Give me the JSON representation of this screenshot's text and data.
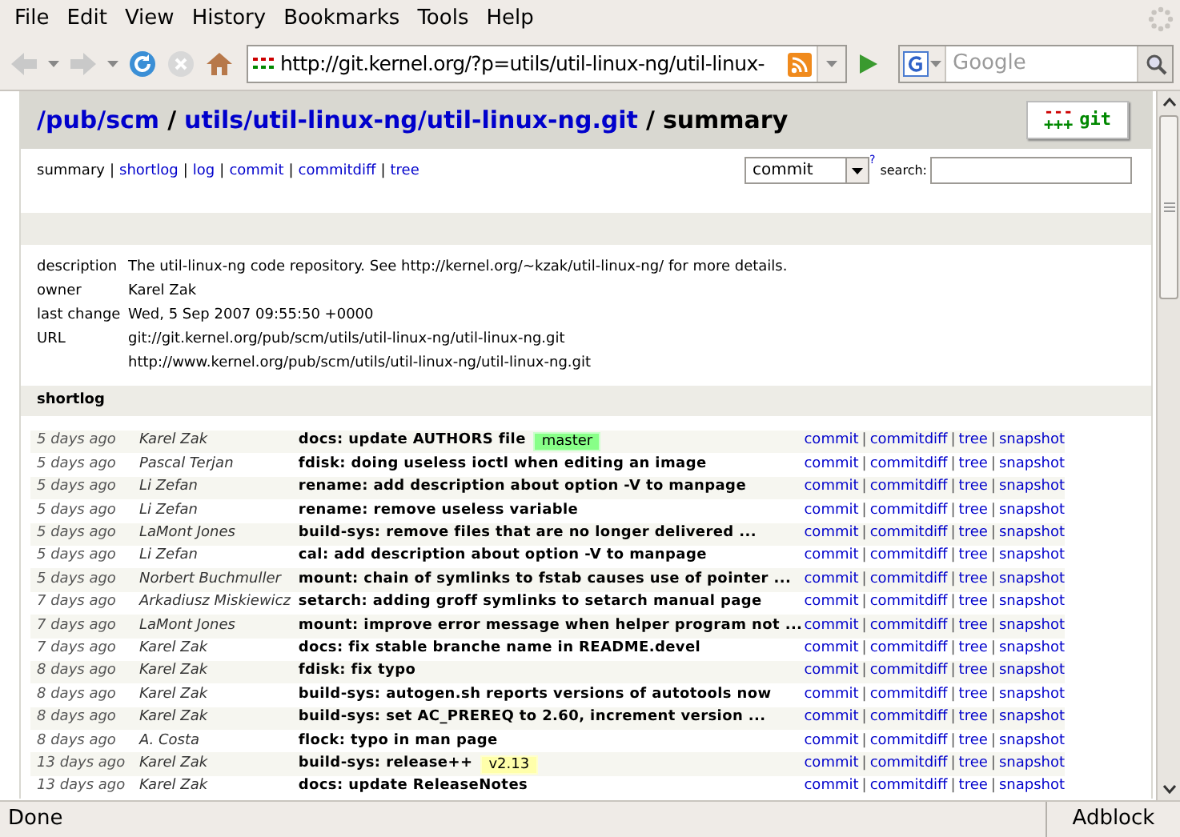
{
  "menu": [
    "File",
    "Edit",
    "View",
    "History",
    "Bookmarks",
    "Tools",
    "Help"
  ],
  "toolbar": {
    "url": "http://git.kernel.org/?p=utils/util-linux-ng/util-linux-",
    "search_placeholder": "Google"
  },
  "page": {
    "breadcrumb": [
      {
        "text": "/pub/scm",
        "link": true
      },
      {
        "text": "/",
        "link": false
      },
      {
        "text": "utils/util-linux-ng/util-linux-ng.git",
        "link": true
      },
      {
        "text": "/",
        "link": false
      },
      {
        "text": "summary",
        "link": false
      }
    ],
    "logo": {
      "minus": "---",
      "plus": "+++",
      "word": "git"
    },
    "nav": [
      {
        "label": "summary",
        "selected": true
      },
      {
        "label": "shortlog",
        "selected": false
      },
      {
        "label": "log",
        "selected": false
      },
      {
        "label": "commit",
        "selected": false
      },
      {
        "label": "commitdiff",
        "selected": false
      },
      {
        "label": "tree",
        "selected": false
      }
    ],
    "separator": "|",
    "search": {
      "type": "commit",
      "help": "?",
      "label": "search:"
    },
    "info": [
      {
        "key": "description",
        "values": [
          "The util-linux-ng code repository. See http://kernel.org/~kzak/util-linux-ng/ for more details."
        ]
      },
      {
        "key": "owner",
        "values": [
          "Karel Zak"
        ]
      },
      {
        "key": "last change",
        "values": [
          "Wed, 5 Sep 2007 09:55:50 +0000"
        ]
      },
      {
        "key": "URL",
        "values": [
          "git://git.kernel.org/pub/scm/utils/util-linux-ng/util-linux-ng.git",
          "http://www.kernel.org/pub/scm/utils/util-linux-ng/util-linux-ng.git"
        ]
      }
    ],
    "shortlog_title": "shortlog",
    "rows": [
      {
        "age": "5 days ago",
        "author": "Karel Zak",
        "title": "docs: update AUTHORS file",
        "links": [
          "commit",
          "commitdiff",
          "tree",
          "snapshot"
        ],
        "ref": {
          "label": "master",
          "kind": "head"
        }
      },
      {
        "age": "5 days ago",
        "author": "Pascal Terjan",
        "title": "fdisk: doing useless ioctl when editing an image",
        "links": [
          "commit",
          "commitdiff",
          "tree",
          "snapshot"
        ]
      },
      {
        "age": "5 days ago",
        "author": "Li Zefan",
        "title": "rename: add description about option -V to manpage",
        "links": [
          "commit",
          "commitdiff",
          "tree",
          "snapshot"
        ]
      },
      {
        "age": "5 days ago",
        "author": "Li Zefan",
        "title": "rename: remove useless variable",
        "links": [
          "commit",
          "commitdiff",
          "tree",
          "snapshot"
        ]
      },
      {
        "age": "5 days ago",
        "author": "LaMont Jones",
        "title": "build-sys: remove files that are no longer delivered ...",
        "links": [
          "commit",
          "commitdiff",
          "tree",
          "snapshot"
        ]
      },
      {
        "age": "5 days ago",
        "author": "Li Zefan",
        "title": "cal: add description about option -V to manpage",
        "links": [
          "commit",
          "commitdiff",
          "tree",
          "snapshot"
        ]
      },
      {
        "age": "5 days ago",
        "author": "Norbert Buchmuller",
        "title": "mount: chain of symlinks to fstab causes use of pointer ...",
        "links": [
          "commit",
          "commitdiff",
          "tree",
          "snapshot"
        ]
      },
      {
        "age": "7 days ago",
        "author": "Arkadiusz Miskiewicz",
        "title": "setarch: adding groff symlinks to setarch manual page",
        "links": [
          "commit",
          "commitdiff",
          "tree",
          "snapshot"
        ]
      },
      {
        "age": "7 days ago",
        "author": "LaMont Jones",
        "title": "mount: improve error message when helper program not ...",
        "links": [
          "commit",
          "commitdiff",
          "tree",
          "snapshot"
        ]
      },
      {
        "age": "7 days ago",
        "author": "Karel Zak",
        "title": "docs: fix stable branche name in README.devel",
        "links": [
          "commit",
          "commitdiff",
          "tree",
          "snapshot"
        ]
      },
      {
        "age": "8 days ago",
        "author": "Karel Zak",
        "title": "fdisk: fix typo",
        "links": [
          "commit",
          "commitdiff",
          "tree",
          "snapshot"
        ]
      },
      {
        "age": "8 days ago",
        "author": "Karel Zak",
        "title": "build-sys: autogen.sh reports versions of autotools now",
        "links": [
          "commit",
          "commitdiff",
          "tree",
          "snapshot"
        ]
      },
      {
        "age": "8 days ago",
        "author": "Karel Zak",
        "title": "build-sys: set AC_PREREQ to 2.60, increment version ...",
        "links": [
          "commit",
          "commitdiff",
          "tree",
          "snapshot"
        ]
      },
      {
        "age": "8 days ago",
        "author": "A. Costa",
        "title": "flock: typo in man page",
        "links": [
          "commit",
          "commitdiff",
          "tree",
          "snapshot"
        ]
      },
      {
        "age": "13 days ago",
        "author": "Karel Zak",
        "title": "build-sys: release++",
        "links": [
          "commit",
          "commitdiff",
          "tree",
          "snapshot"
        ],
        "ref": {
          "label": "v2.13",
          "kind": "tag"
        }
      },
      {
        "age": "13 days ago",
        "author": "Karel Zak",
        "title": "docs: update ReleaseNotes",
        "links": [
          "commit",
          "commitdiff",
          "tree",
          "snapshot"
        ]
      }
    ]
  },
  "status_bar": {
    "text": "Done",
    "addon": "Adblock"
  }
}
